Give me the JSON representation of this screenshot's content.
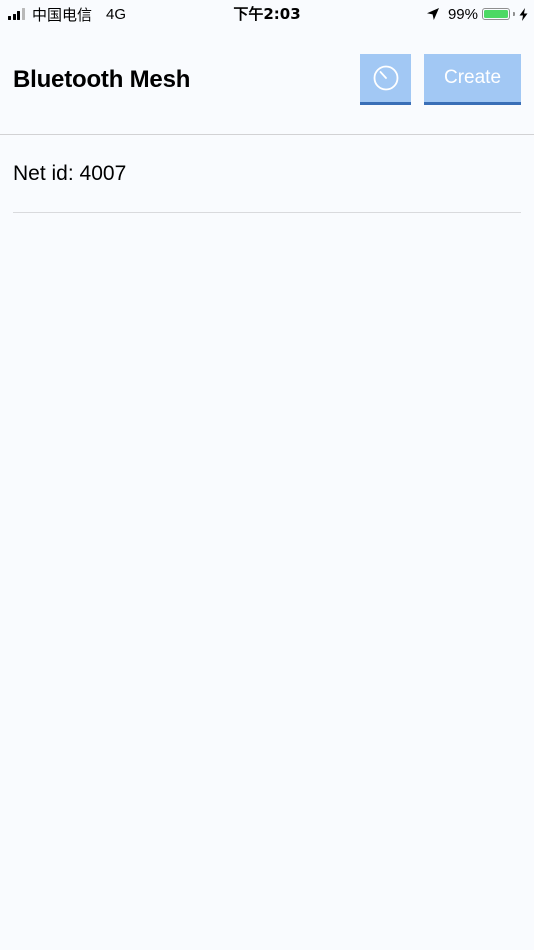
{
  "status_bar": {
    "carrier": "中国电信",
    "network": "4G",
    "time": "下午2:03",
    "battery_percent_text": "99%",
    "battery_level": 0.99,
    "battery_color": "#4cd964",
    "icons": [
      "signal-icon",
      "location-arrow-icon",
      "battery-icon",
      "charging-bolt-icon"
    ]
  },
  "header": {
    "title": "Bluetooth Mesh",
    "history_icon": "timer-icon",
    "create_label": "Create",
    "button_color": "#a2c8f4",
    "button_underline_color": "#3a6fb7"
  },
  "networks": [
    {
      "label": "Net id: 4007"
    }
  ]
}
